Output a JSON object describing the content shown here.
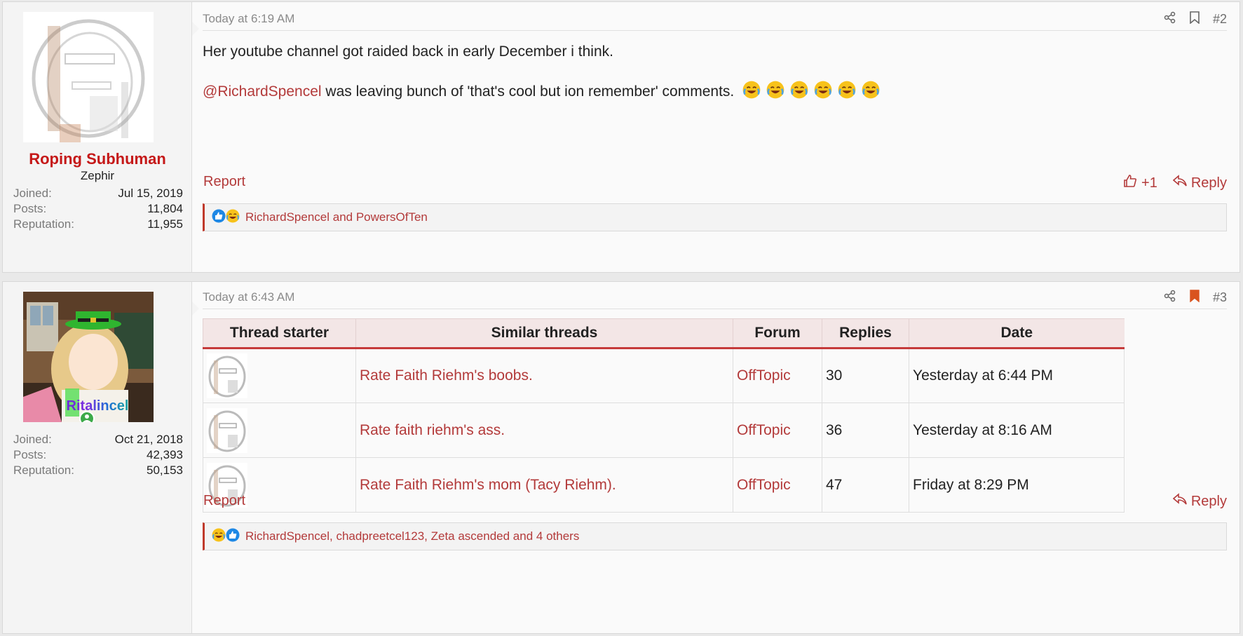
{
  "posts": [
    {
      "user": {
        "name": "Roping Subhuman",
        "name_color": "#c51818",
        "title": "Zephir",
        "stats": [
          {
            "key": "Joined:",
            "value": "Jul 15, 2019"
          },
          {
            "key": "Posts:",
            "value": "11,804"
          },
          {
            "key": "Reputation:",
            "value": "11,955"
          }
        ]
      },
      "time": "Today at 6:19 AM",
      "number": "#2",
      "bookmarked": false,
      "lines": [
        "Her youtube channel got raided back in early December i think.",
        "was leaving bunch of 'that's cool but ion remember' comments."
      ],
      "mention": "@RichardSpencel",
      "emoji_icons": [
        "joy-emoji",
        "joy-emoji",
        "joy-emoji",
        "joy-emoji",
        "joy-emoji",
        "joy-emoji"
      ],
      "report_label": "Report",
      "like_label": "+1",
      "reply_label": "Reply",
      "reactions": "RichardSpencel and PowersOfTen"
    },
    {
      "user": {
        "name": "Ritalincel",
        "title": "",
        "stats": [
          {
            "key": "Joined:",
            "value": "Oct 21, 2018"
          },
          {
            "key": "Posts:",
            "value": "42,393"
          },
          {
            "key": "Reputation:",
            "value": "50,153"
          }
        ]
      },
      "time": "Today at 6:43 AM",
      "number": "#3",
      "bookmarked": true,
      "report_label": "Report",
      "reply_label": "Reply",
      "reactions": "RichardSpencel, chadpreetcel123, Zeta ascended and 4 others"
    }
  ],
  "similar_threads": {
    "headers": [
      "Thread starter",
      "Similar threads",
      "Forum",
      "Replies",
      "Date"
    ],
    "rows": [
      {
        "title": "Rate Faith Riehm's boobs.",
        "forum": "OffTopic",
        "replies": "30",
        "date": "Yesterday at 6:44 PM"
      },
      {
        "title": "Rate faith riehm's ass.",
        "forum": "OffTopic",
        "replies": "36",
        "date": "Yesterday at 8:16 AM"
      },
      {
        "title": "Rate Faith Riehm's mom (Tacy Riehm).",
        "forum": "OffTopic",
        "replies": "47",
        "date": "Friday at 8:29 PM"
      }
    ]
  },
  "colors": {
    "accent": "#b33a3a",
    "table_header_bg": "#f3e6e6",
    "bookmark_active": "#d9531e",
    "online": "#3daa4a"
  }
}
